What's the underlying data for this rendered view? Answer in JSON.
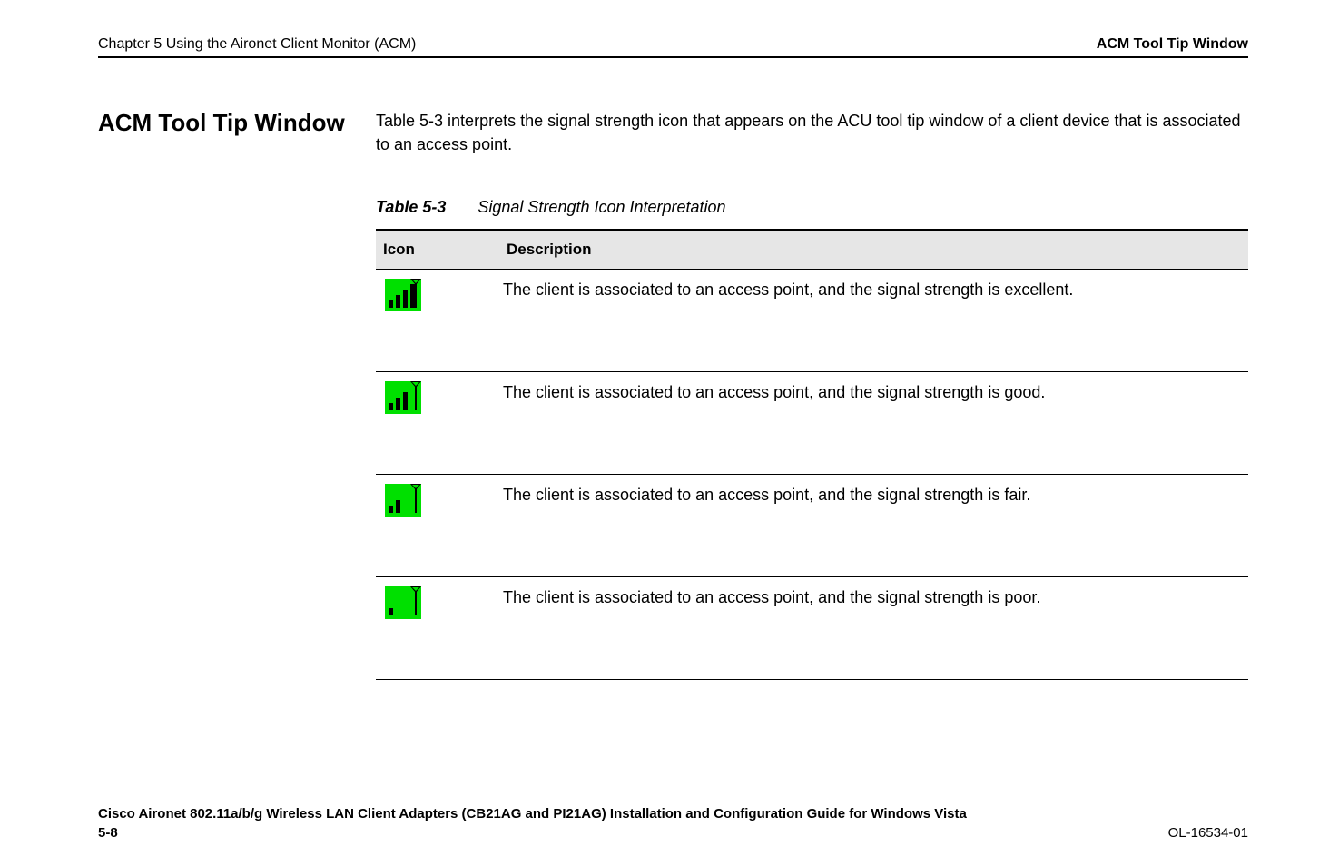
{
  "header": {
    "chapter": "Chapter 5      Using the Aironet Client Monitor (ACM)",
    "section": "ACM Tool Tip Window"
  },
  "section_heading": "ACM Tool Tip Window",
  "intro": "Table 5-3 interprets the signal strength icon that appears on the ACU tool tip window of a client device that is associated to an access point.",
  "table": {
    "caption_label": "Table 5-3",
    "caption_text": "Signal Strength Icon Interpretation",
    "headers": {
      "icon": "Icon",
      "description": "Description"
    },
    "rows": [
      {
        "bars": 4,
        "desc": "The client is associated to an access point, and the signal strength is excellent."
      },
      {
        "bars": 3,
        "desc": "The client is associated to an access point, and the signal strength is good."
      },
      {
        "bars": 2,
        "desc": "The client is associated to an access point, and the signal strength is fair."
      },
      {
        "bars": 1,
        "desc": "The client is associated to an access point, and the signal strength is poor."
      }
    ]
  },
  "footer": {
    "doc_title": "Cisco Aironet 802.11a/b/g Wireless LAN Client Adapters (CB21AG and PI21AG) Installation and Configuration Guide for Windows Vista",
    "page_number": "5-8",
    "doc_id": "OL-16534-01"
  }
}
